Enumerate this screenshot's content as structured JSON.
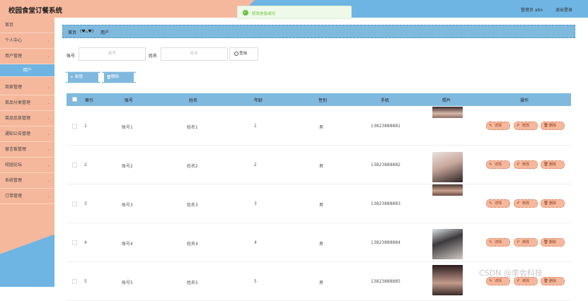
{
  "header": {
    "title": "校园食堂订餐系统",
    "user": "管理员 abo",
    "logout": "退出登录"
  },
  "toast": {
    "icon": "✓",
    "message": "修改信息成功"
  },
  "sidebar": {
    "items": [
      {
        "label": "首页",
        "chevron": false,
        "active": false
      },
      {
        "label": "个人中心",
        "chevron": true,
        "active": false
      },
      {
        "label": "用户管理",
        "chevron": true,
        "active": false
      },
      {
        "label": "用户",
        "chevron": false,
        "active": true
      },
      {
        "label": "商家管理",
        "chevron": true,
        "active": false
      },
      {
        "label": "菜品分类管理",
        "chevron": true,
        "active": false
      },
      {
        "label": "菜品信息管理",
        "chevron": true,
        "active": false
      },
      {
        "label": "通知公告管理",
        "chevron": true,
        "active": false
      },
      {
        "label": "留言板管理",
        "chevron": true,
        "active": false
      },
      {
        "label": "校园论坛",
        "chevron": true,
        "active": false
      },
      {
        "label": "系统管理",
        "chevron": true,
        "active": false
      },
      {
        "label": "订单管理",
        "chevron": true,
        "active": false
      }
    ]
  },
  "breadcrumb": {
    "home": "首页",
    "face": "(♥ᴗ♥)",
    "current": "用户"
  },
  "search": {
    "account_label": "账号",
    "account_placeholder": "账号",
    "name_label": "姓名",
    "name_placeholder": "姓名",
    "button": "查询"
  },
  "toolbar": {
    "add": "新增",
    "delete": "删除"
  },
  "table": {
    "headers": [
      "索引",
      "账号",
      "姓名",
      "年龄",
      "性别",
      "手机",
      "照片",
      "操作"
    ],
    "actions": {
      "detail": "详情",
      "edit": "修改",
      "delete": "删除"
    },
    "rows": [
      {
        "index": "1",
        "account": "账号1",
        "name": "姓名1",
        "age": "1",
        "gender": "男",
        "phone": "13823888881"
      },
      {
        "index": "2",
        "account": "账号2",
        "name": "姓名2",
        "age": "2",
        "gender": "男",
        "phone": "13823888882"
      },
      {
        "index": "3",
        "account": "账号3",
        "name": "姓名3",
        "age": "3",
        "gender": "男",
        "phone": "13823888883"
      },
      {
        "index": "4",
        "account": "账号4",
        "name": "姓名4",
        "age": "4",
        "gender": "男",
        "phone": "13823888884"
      },
      {
        "index": "5",
        "account": "账号5",
        "name": "姓名5",
        "age": "5",
        "gender": "男",
        "phone": "13823888885"
      }
    ]
  },
  "watermark": "CSDN @李会科技",
  "colors": {
    "accent_blue": "#7fb9dd",
    "accent_peach": "#f5b89c",
    "success": "#67c23a"
  }
}
